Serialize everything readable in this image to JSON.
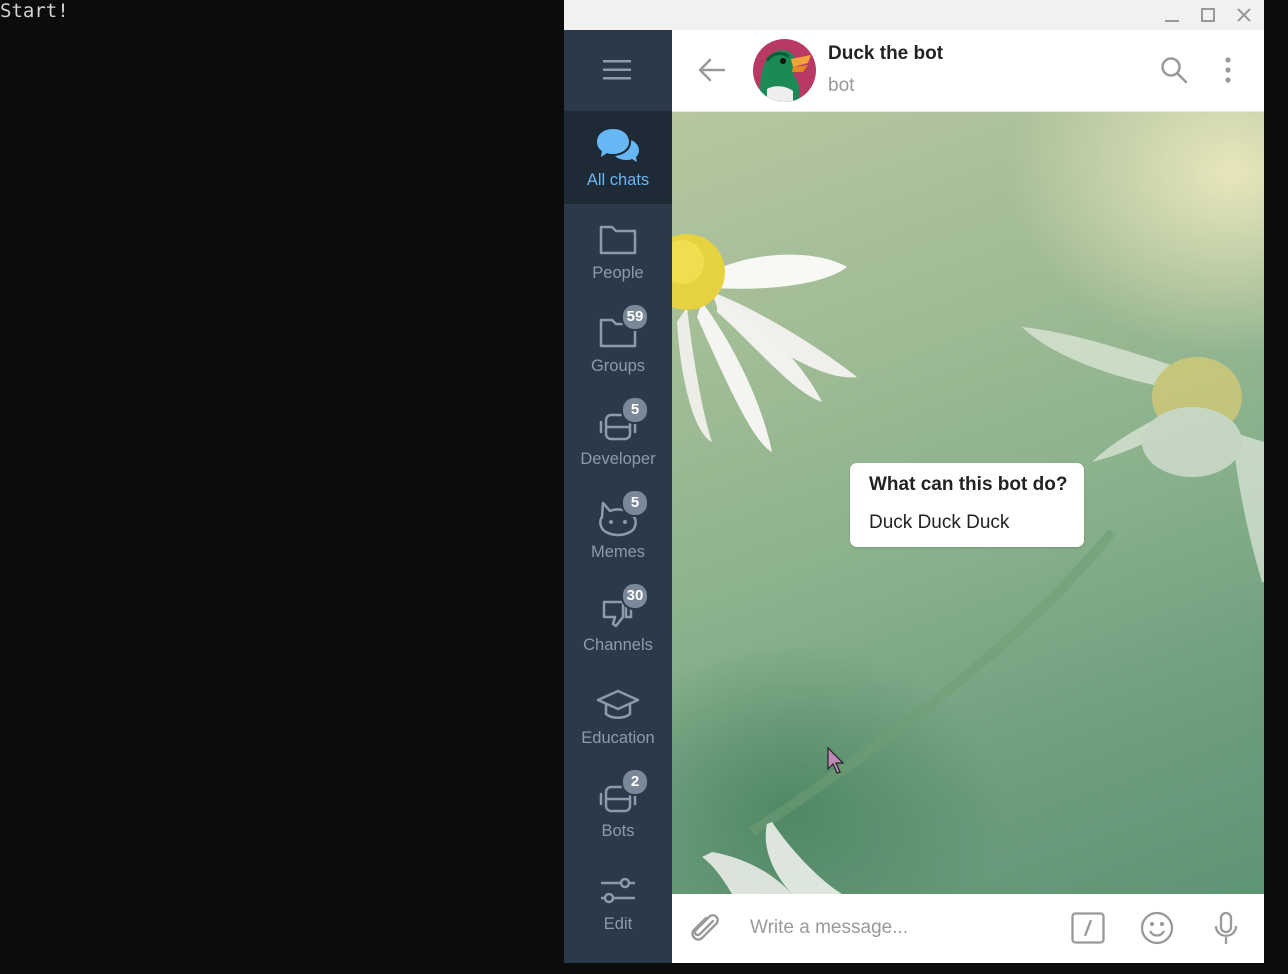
{
  "terminal": {
    "text": "Start!"
  },
  "sidebar": {
    "folders": [
      {
        "label": "All chats",
        "icon": "chat-bubbles-icon",
        "badge": "",
        "active": true
      },
      {
        "label": "People",
        "icon": "folder-icon",
        "badge": ""
      },
      {
        "label": "Groups",
        "icon": "folder-icon",
        "badge": "59"
      },
      {
        "label": "Developer",
        "icon": "robot-icon",
        "badge": "5"
      },
      {
        "label": "Memes",
        "icon": "cat-icon",
        "badge": "5"
      },
      {
        "label": "Channels",
        "icon": "thumbs-down-icon",
        "badge": "30"
      },
      {
        "label": "Education",
        "icon": "graduation-cap-icon",
        "badge": ""
      },
      {
        "label": "Bots",
        "icon": "robot-icon",
        "badge": "2"
      },
      {
        "label": "Edit",
        "icon": "sliders-icon",
        "badge": ""
      }
    ]
  },
  "header": {
    "title": "Duck the bot",
    "status": "bot"
  },
  "bot_info": {
    "title": "What can this bot do?",
    "description": "Duck Duck Duck"
  },
  "composer": {
    "placeholder": "Write a message..."
  },
  "colors": {
    "sidebar": "#2b3a4b",
    "sidebar_active": "#1f2a37",
    "accent": "#67b7f5",
    "badge": "#7a8898"
  }
}
